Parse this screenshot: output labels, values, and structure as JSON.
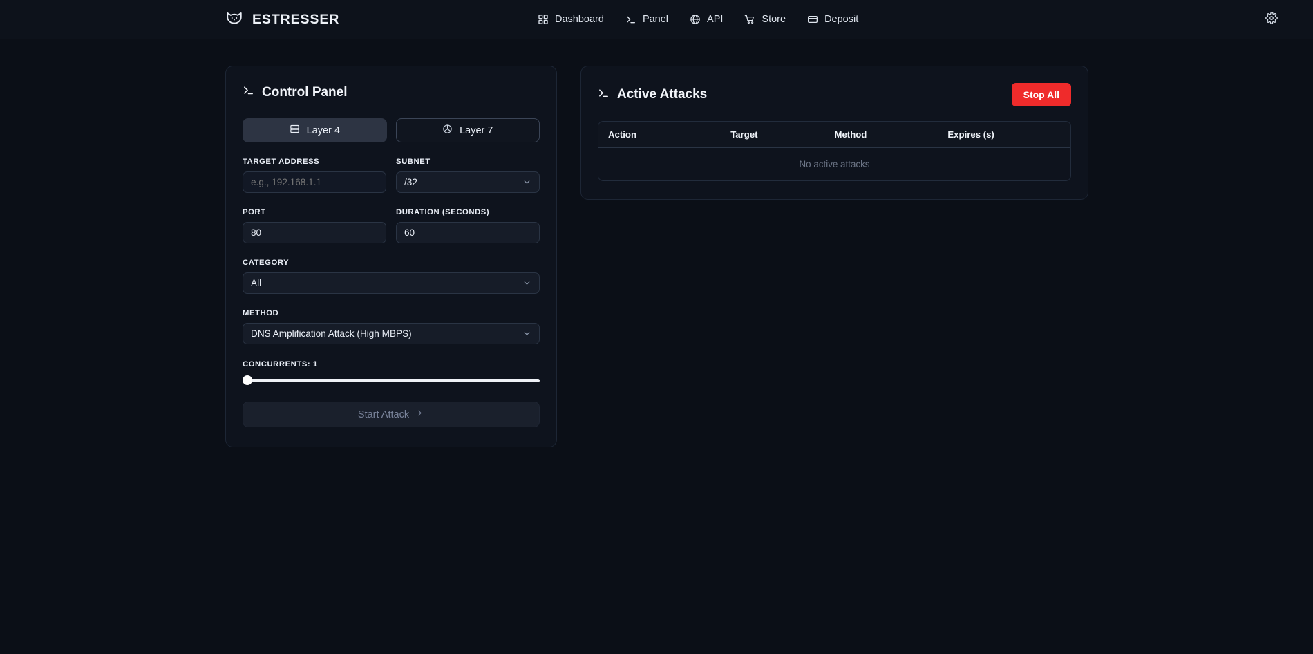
{
  "topbar": {
    "brand": "ESTRESSER",
    "logo_icon": "cat-head-icon",
    "nav": [
      {
        "label": "Dashboard",
        "icon": "grid-icon"
      },
      {
        "label": "Panel",
        "icon": "terminal-icon"
      },
      {
        "label": "API",
        "icon": "globe-icon"
      },
      {
        "label": "Store",
        "icon": "shopping-cart-icon"
      },
      {
        "label": "Deposit",
        "icon": "credit-card-icon"
      }
    ],
    "settings_icon": "gear-icon"
  },
  "control_panel": {
    "title": "Control Panel",
    "title_icon": "terminal-icon",
    "tabs": [
      {
        "label": "Layer 4",
        "icon": "server-icon",
        "active": true
      },
      {
        "label": "Layer 7",
        "icon": "globe-icon",
        "active": false
      }
    ],
    "target_address": {
      "label": "TARGET ADDRESS",
      "value": "",
      "placeholder": "e.g., 192.168.1.1"
    },
    "subnet": {
      "label": "SUBNET",
      "value": "/32"
    },
    "port": {
      "label": "PORT",
      "value": "80"
    },
    "duration": {
      "label": "DURATION (SECONDS)",
      "value": "60"
    },
    "category": {
      "label": "CATEGORY",
      "value": "All"
    },
    "method": {
      "label": "METHOD",
      "value": "DNS Amplification Attack (High MBPS)"
    },
    "concurrents": {
      "label": "CONCURRENTS: 1",
      "value": 1,
      "min": 1,
      "percent": 0
    },
    "start_button": {
      "label": "Start Attack",
      "chevron": "›",
      "disabled": true
    }
  },
  "active_attacks": {
    "title": "Active Attacks",
    "title_icon": "terminal-icon",
    "stop_all_label": "Stop All",
    "stop_all_color": "#ef2b2b",
    "columns": [
      "Action",
      "Target",
      "Method",
      "Expires (s)"
    ],
    "rows": [],
    "empty_message": "No active attacks"
  }
}
